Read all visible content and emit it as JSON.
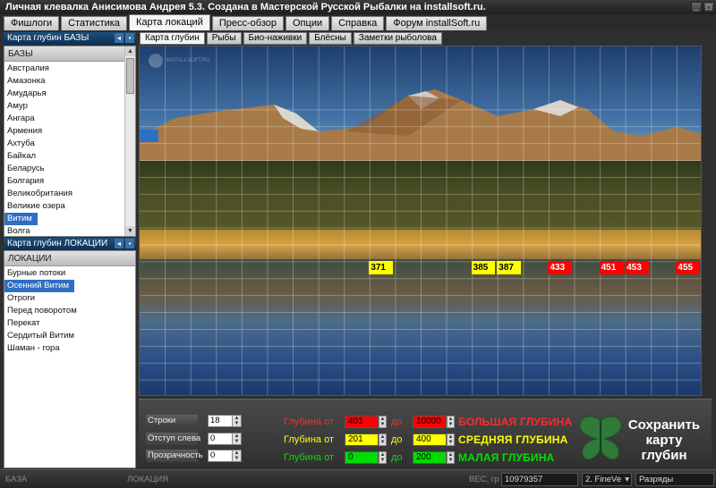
{
  "window": {
    "title": "Личная клевалка Анисимова Андрея 5.3. Создана в Мастерской Русской Рыбалки на installsoft.ru.",
    "controls": [
      "_",
      "□"
    ]
  },
  "main_tabs": [
    "Фишлоги",
    "Статистика",
    "Карта локаций",
    "Пресс-обзор",
    "Опции",
    "Справка",
    "Форум installSoft.ru"
  ],
  "bases_pane": {
    "title": "Карта глубин БАЗЫ",
    "header": "БАЗЫ",
    "items": [
      "Австралия",
      "Амазонка",
      "Амударья",
      "Амур",
      "Ангара",
      "Армения",
      "Ахтуба",
      "Байкал",
      "Беларусь",
      "Болгария",
      "Великобритания",
      "Великие озера",
      "Витим",
      "Волга"
    ],
    "selected": "Витим"
  },
  "locations_pane": {
    "title": "Карта глубин ЛОКАЦИИ",
    "header": "ЛОКАЦИИ",
    "items": [
      "Бурные потоки",
      "Осенний Витим",
      "Отроги",
      "Перед поворотом",
      "Перекат",
      "Сердитый Витим",
      "Шаман - гора"
    ],
    "selected": "Осенний Витим"
  },
  "sub_tabs": [
    "Карта глубин",
    "Рыбы",
    "Био-наживки",
    "Блёсны",
    "Заметки рыболова"
  ],
  "watermark": "INSTALLSOFT.RU",
  "depth_markers": [
    {
      "value": "371",
      "color": "#ffff00",
      "text_color": "#000000"
    },
    {
      "value": "385",
      "color": "#ffff00",
      "text_color": "#000000"
    },
    {
      "value": "387",
      "color": "#ffff00",
      "text_color": "#000000"
    },
    {
      "value": "433",
      "color": "#ff0000",
      "text_color": "#ffffff"
    },
    {
      "value": "451",
      "color": "#ff0000",
      "text_color": "#ffffff"
    },
    {
      "value": "453",
      "color": "#ff0000",
      "text_color": "#ffffff"
    },
    {
      "value": "455",
      "color": "#ff0000",
      "text_color": "#ffffff"
    }
  ],
  "controls": {
    "rows_label": "Строки",
    "rows_value": "18",
    "left_margin_label": "Отступ слева",
    "left_margin_value": "0",
    "transparency_label": "Прозрачность",
    "transparency_value": "0"
  },
  "depth_ranges": [
    {
      "label": "Глубина от",
      "from": "401",
      "to_label": "до",
      "to": "10000",
      "name": "БОЛЬШАЯ ГЛУБИНА",
      "color": "#ff0000",
      "label_color": "#ff2a2a"
    },
    {
      "label": "Глубина от",
      "from": "201",
      "to_label": "до",
      "to": "400",
      "name": "СРЕДНЯЯ ГЛУБИНА",
      "color": "#ffff00",
      "label_color": "#ffff00"
    },
    {
      "label": "Глубина от",
      "from": "0",
      "to_label": "до",
      "to": "200",
      "name": "МАЛАЯ ГЛУБИНА",
      "color": "#00dd00",
      "label_color": "#00e000"
    }
  ],
  "save_button": "Сохранить карту глубин",
  "status_bar": {
    "base_label": "БАЗА",
    "location_label": "ЛОКАЦИЯ",
    "weight_label": "ВЕС, гр",
    "weight_value": "10979357",
    "mode_value": "2. FineVe",
    "ranks_label": "Разряды"
  },
  "icons": {
    "scroll_up": "up-arrow-icon",
    "scroll_down": "down-arrow-icon",
    "spin": "spin-arrows-icon",
    "butterfly": "butterfly-logo-icon"
  }
}
